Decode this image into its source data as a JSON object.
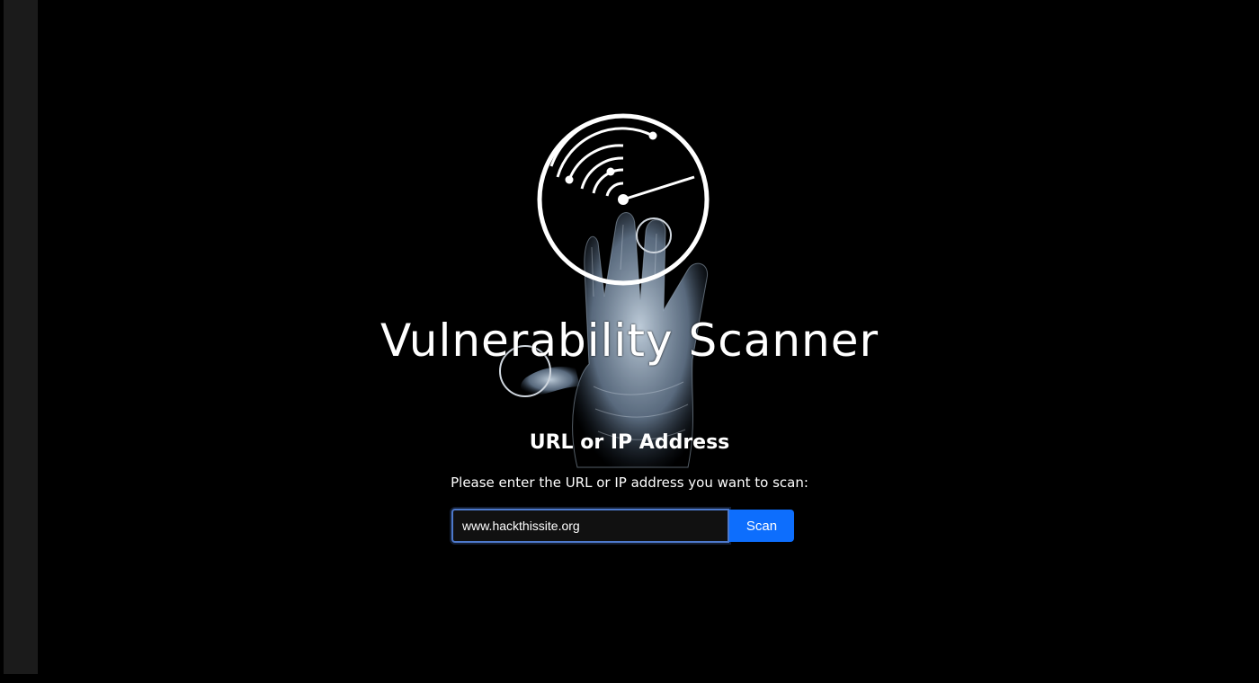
{
  "header": {
    "title": "Vulnerability Scanner"
  },
  "form": {
    "section_title": "URL or IP Address",
    "instruction": "Please enter the URL or IP address you want to scan:",
    "input_value": "www.hackthissite.org",
    "scan_label": "Scan"
  },
  "icons": {
    "radar": "radar-icon",
    "hand": "handprint-icon"
  },
  "colors": {
    "background": "#000000",
    "accent": "#0d6efd",
    "text": "#ffffff"
  }
}
